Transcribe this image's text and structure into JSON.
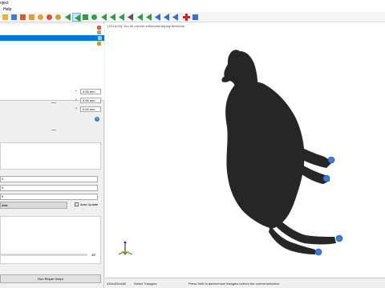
{
  "window": {
    "title_fragment": "oject"
  },
  "menu": {
    "help_label": "Help"
  },
  "toolbar": {
    "buttons": [
      {
        "name": "open-file-icon",
        "color": "#f2b134"
      },
      {
        "name": "grid-icon",
        "color": "#4a79c9"
      },
      {
        "name": "import-icon",
        "color": "#d85b2a"
      },
      {
        "name": "export-icon",
        "color": "#e89a3c"
      },
      {
        "name": "settings-gear-icon",
        "color": "#e4a22b"
      },
      {
        "name": "color-wheel-icon",
        "color": "#e24b3a"
      },
      {
        "name": "magnifier-icon",
        "color": "#c8a42a"
      },
      {
        "name": "arrow-left-icon",
        "color": "#2f9e44"
      },
      {
        "name": "select-triangle-icon",
        "color": "#2f9e44"
      },
      {
        "name": "rotate-icon",
        "color": "#2f9e44"
      },
      {
        "name": "circle-select-icon",
        "color": "#2f9e44"
      },
      {
        "name": "shrink-icon",
        "color": "#2f9e44"
      },
      {
        "name": "flag-left-icon",
        "color": "#2f9e44"
      },
      {
        "name": "flag-mid-icon",
        "color": "#2f9e44"
      },
      {
        "name": "flag-right-icon",
        "color": "#555555"
      },
      {
        "name": "select-left-icon",
        "color": "#2f9e44"
      },
      {
        "name": "select-mid-icon",
        "color": "#2f9e44"
      },
      {
        "name": "select-blue-1-icon",
        "color": "#2f6fd0"
      },
      {
        "name": "select-blue-2-icon",
        "color": "#2f6fd0"
      },
      {
        "name": "select-blue-3-icon",
        "color": "#2f6fd0"
      },
      {
        "name": "add-red-cross-icon",
        "color": "#e02020"
      },
      {
        "name": "part-icon",
        "color": "#3a6fd0"
      }
    ]
  },
  "left_panel": {
    "offsets": [
      {
        "arrow": "›",
        "value": "0.00 mm"
      },
      {
        "arrow": "›",
        "value": "0.00 mm"
      },
      {
        "arrow": "›",
        "value": "0.00 mm"
      }
    ],
    "numbers": [
      "0",
      "0",
      "0"
    ],
    "update_label": "date",
    "auto_update_label": "Auto Update",
    "slider_value": "45°",
    "repair_button_label": "Run Repair Script"
  },
  "viewport": {
    "message": "[13:16:25]: You do not use enhanced display functions",
    "model_color": "#262626",
    "hoof_color": "#3a7fd8"
  },
  "status": {
    "resolution": "430x420x480",
    "mode": "Select Triangles",
    "hint": "Press Shift to add/remove triangles to/from the current selection."
  }
}
